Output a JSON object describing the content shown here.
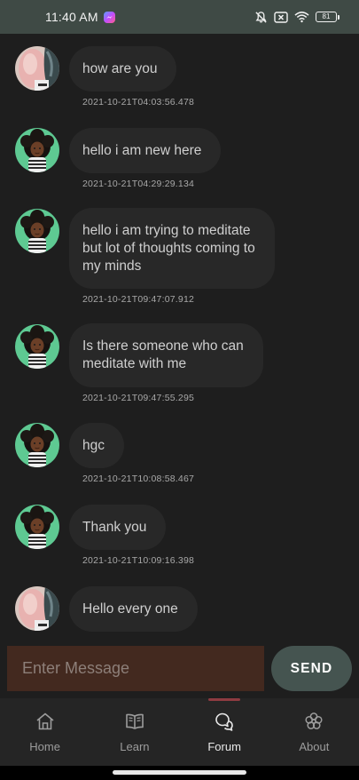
{
  "status_bar": {
    "time": "11:40 AM",
    "battery": "81",
    "icons": [
      "messenger-icon",
      "bell-off-icon",
      "sim-x-icon",
      "wifi-icon",
      "battery-icon"
    ]
  },
  "messages": [
    {
      "avatar": "avatar-photo",
      "text_lines": [
        "how are you"
      ],
      "timestamp": "2021-10-21T04:03:56.478"
    },
    {
      "avatar": "avatar-cartoon",
      "text_lines": [
        "hello i am new here"
      ],
      "timestamp": "2021-10-21T04:29:29.134"
    },
    {
      "avatar": "avatar-cartoon",
      "text_lines": [
        "hello i am trying to meditate",
        "but lot of thoughts coming to",
        "my minds"
      ],
      "timestamp": "2021-10-21T09:47:07.912"
    },
    {
      "avatar": "avatar-cartoon",
      "text_lines": [
        "Is there someone who can",
        "meditate with me"
      ],
      "timestamp": "2021-10-21T09:47:55.295"
    },
    {
      "avatar": "avatar-cartoon",
      "text_lines": [
        "hgc"
      ],
      "timestamp": "2021-10-21T10:08:58.467"
    },
    {
      "avatar": "avatar-cartoon",
      "text_lines": [
        "Thank you"
      ],
      "timestamp": "2021-10-21T10:09:16.398"
    },
    {
      "avatar": "avatar-photo",
      "text_lines": [
        "Hello every one"
      ],
      "timestamp": ""
    }
  ],
  "composer": {
    "placeholder": "Enter Message",
    "value": "",
    "send_label": "SEND"
  },
  "nav": {
    "items": [
      {
        "label": "Home",
        "icon": "home-icon",
        "active": false
      },
      {
        "label": "Learn",
        "icon": "book-icon",
        "active": false
      },
      {
        "label": "Forum",
        "icon": "chat-bubbles-icon",
        "active": true
      },
      {
        "label": "About",
        "icon": "flower-icon",
        "active": false
      }
    ]
  },
  "colors": {
    "status_bar_bg": "#3f4a45",
    "background": "#1e1e1e",
    "bubble_bg": "#282828",
    "input_bg": "#43291f",
    "send_bg": "#455450",
    "nav_bg": "#252525",
    "nav_indicator": "#8e3b41",
    "avatar_green": "#5ec992"
  }
}
